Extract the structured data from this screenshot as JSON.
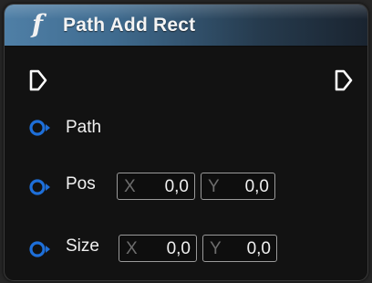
{
  "node": {
    "icon": "function-icon",
    "icon_glyph": "f",
    "title": "Path Add Rect",
    "header_color": "#4f7fa6",
    "pin_color": "#1e6fd9"
  },
  "pins": {
    "path": {
      "label": "Path"
    },
    "pos": {
      "label": "Pos",
      "x_axis": "X",
      "x_value": "0,0",
      "y_axis": "Y",
      "y_value": "0,0"
    },
    "size": {
      "label": "Size",
      "x_axis": "X",
      "x_value": "0,0",
      "y_axis": "Y",
      "y_value": "0,0"
    }
  }
}
